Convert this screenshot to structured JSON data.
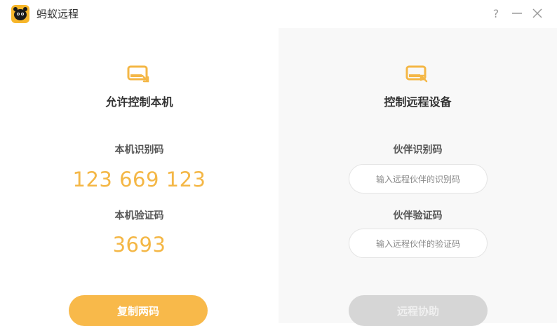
{
  "app": {
    "title": "蚂蚁远程",
    "logo_color": "#f7b62a",
    "help_label": "?"
  },
  "left": {
    "title": "允许控制本机",
    "icon": "screen-share-icon",
    "id_label": "本机识别码",
    "id_value": "123 669 123",
    "code_label": "本机验证码",
    "code_value": "3693",
    "copy_button": "复制两码"
  },
  "right": {
    "title": "控制远程设备",
    "icon": "remote-control-icon",
    "partner_id_label": "伙伴识别码",
    "partner_id_placeholder": "输入远程伙伴的识别码",
    "partner_code_label": "伙伴验证码",
    "partner_code_placeholder": "输入远程伙伴的验证码",
    "connect_button": "远程协助"
  },
  "colors": {
    "accent": "#f4b746",
    "button_active": "#f8b94a",
    "button_disabled": "#d6d6d6"
  }
}
